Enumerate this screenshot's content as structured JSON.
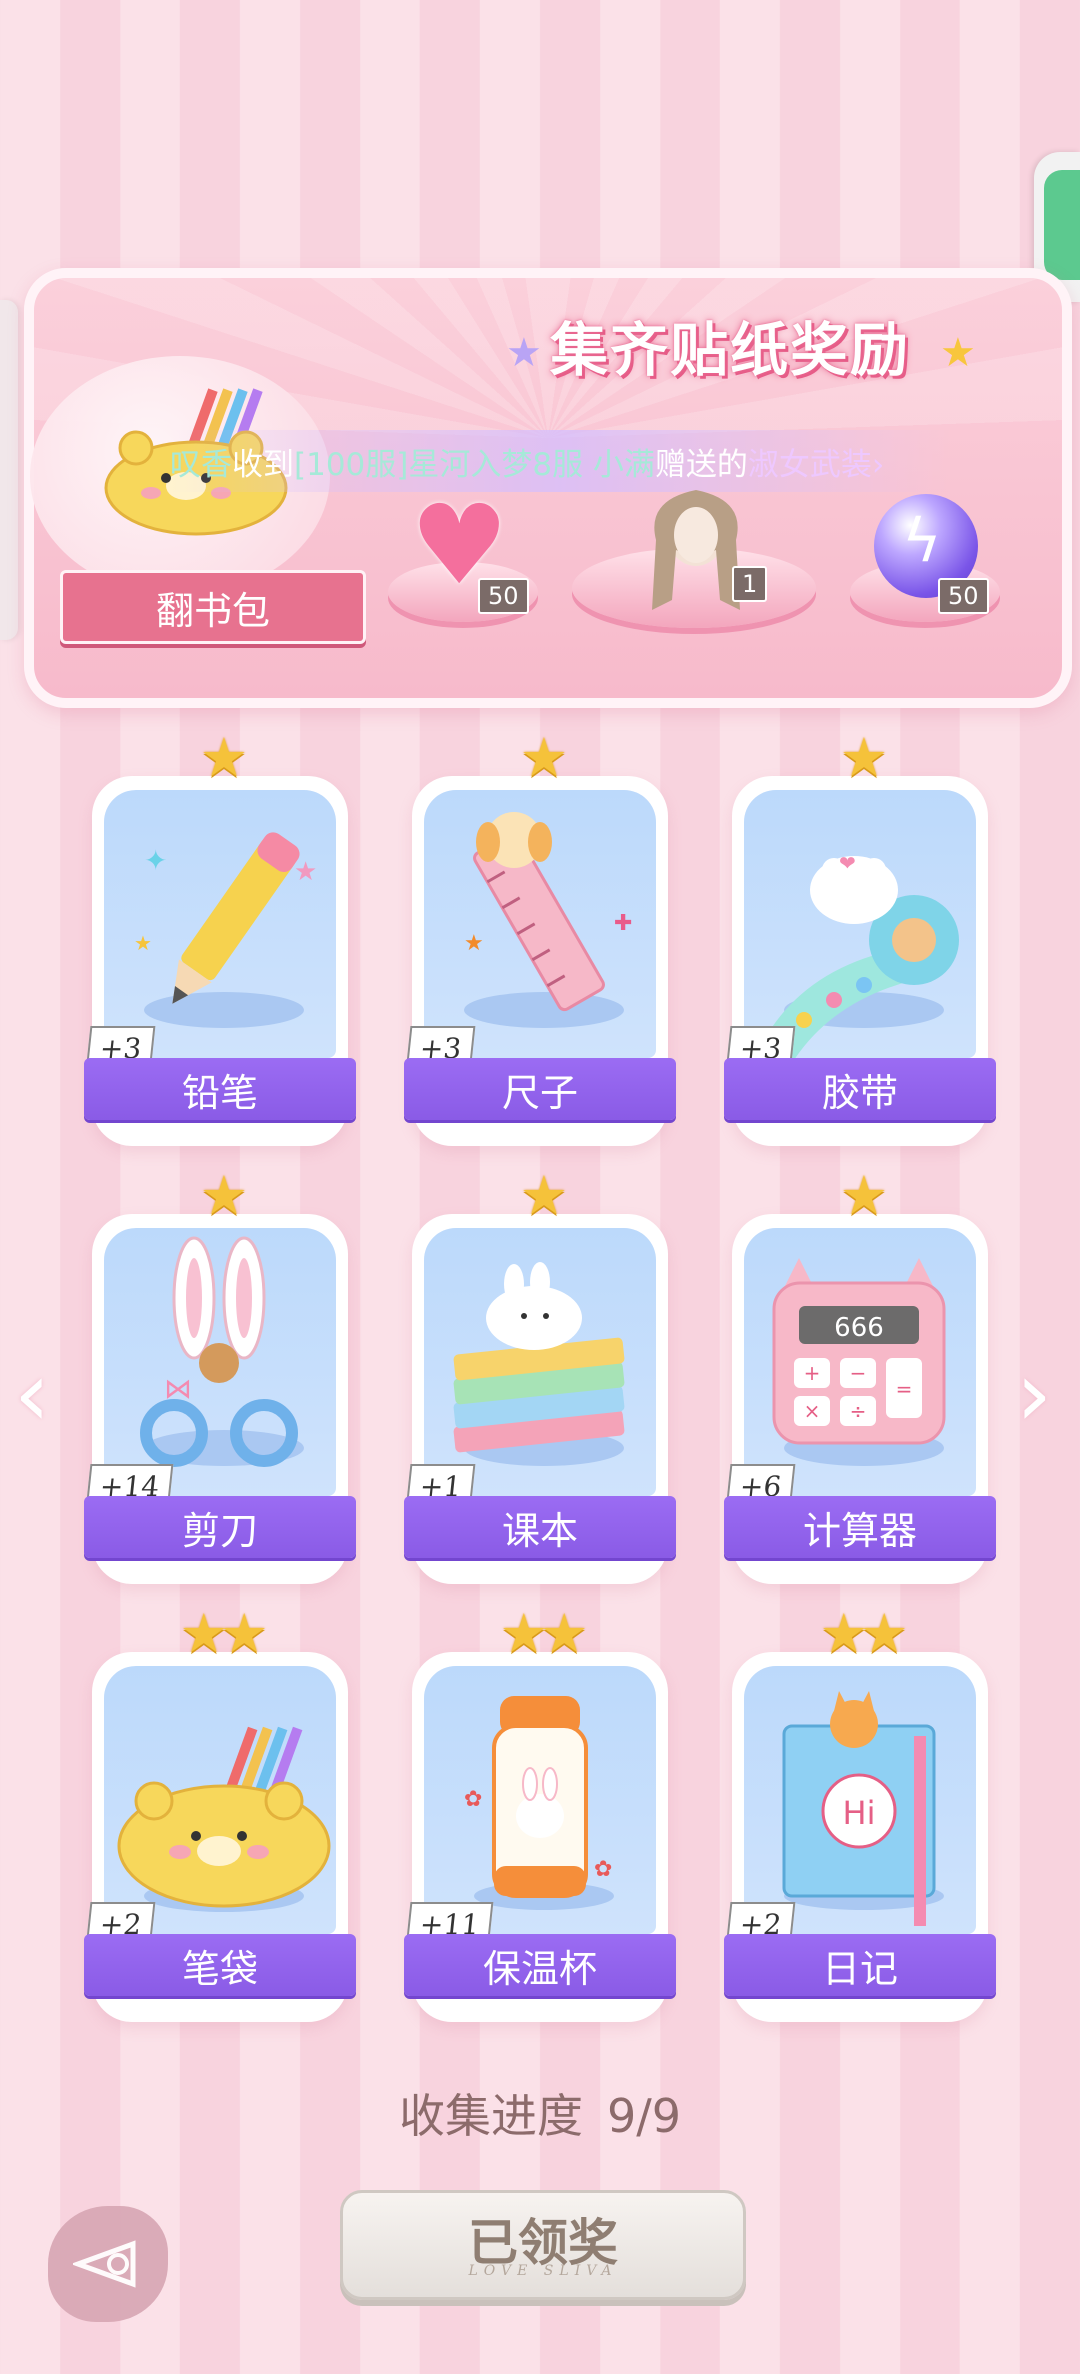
{
  "reward": {
    "title": "集齐贴纸奖励",
    "bag_label": "翻书包",
    "marquee": {
      "part1": "叹香",
      "part2": "收到",
      "part3": "[100服]星河入梦8服 小满",
      "part4": "赠送的",
      "part5": "淑女武装›"
    },
    "rewards": [
      {
        "name": "heart-gem",
        "qty": "50"
      },
      {
        "name": "avatar-outfit",
        "qty": "1"
      },
      {
        "name": "energy-orb",
        "qty": "50"
      }
    ]
  },
  "cards": [
    {
      "label": "铅笔",
      "count": "+3",
      "stars": "★"
    },
    {
      "label": "尺子",
      "count": "+3",
      "stars": "★"
    },
    {
      "label": "胶带",
      "count": "+3",
      "stars": "★"
    },
    {
      "label": "剪刀",
      "count": "+14",
      "stars": "★"
    },
    {
      "label": "课本",
      "count": "+1",
      "stars": "★"
    },
    {
      "label": "计算器",
      "count": "+6",
      "stars": "★",
      "display": "666"
    },
    {
      "label": "笔袋",
      "count": "+2",
      "stars": "★★"
    },
    {
      "label": "保温杯",
      "count": "+11",
      "stars": "★★"
    },
    {
      "label": "日记",
      "count": "+2",
      "stars": "★★",
      "bubble": "Hi"
    }
  ],
  "progress": {
    "label": "收集进度",
    "value": "9/9"
  },
  "claim": {
    "label": "已领奖",
    "sub": "LOVE SLIVA"
  },
  "colors": {
    "ribbon": "#9b6cf3",
    "accent": "#e7728f",
    "star": "#f5c23a"
  }
}
